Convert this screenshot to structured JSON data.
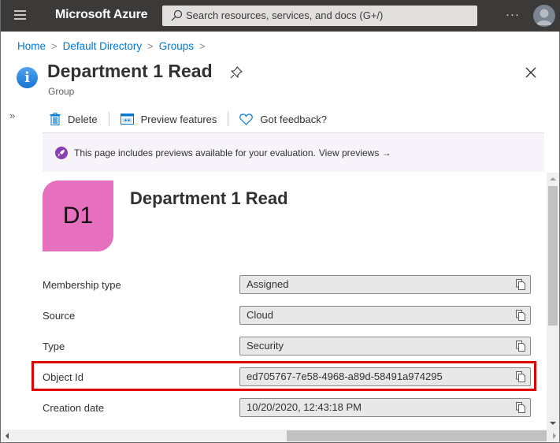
{
  "topbar": {
    "brand": "Microsoft Azure",
    "search_placeholder": "Search resources, services, and docs (G+/)",
    "more_label": "···",
    "menu_icon": "hamburger-icon",
    "avatar_icon": "user-avatar-icon"
  },
  "breadcrumb": {
    "items": [
      "Home",
      "Default Directory",
      "Groups"
    ],
    "separator": ">"
  },
  "header": {
    "title": "Department 1 Read",
    "subtitle": "Group",
    "icon": "info-icon",
    "icon_glyph": "i"
  },
  "toolbar": {
    "delete_label": "Delete",
    "preview_label": "Preview features",
    "feedback_label": "Got feedback?",
    "expand_glyph": "»"
  },
  "banner": {
    "text": "This page includes previews available for your evaluation.",
    "link": "View previews →",
    "accent": "#8a3eb4"
  },
  "group": {
    "initials": "D1",
    "name": "Department 1 Read",
    "avatar_color": "#e670bd"
  },
  "fields": [
    {
      "label": "Membership type",
      "value": "Assigned"
    },
    {
      "label": "Source",
      "value": "Cloud"
    },
    {
      "label": "Type",
      "value": "Security"
    },
    {
      "label": "Object Id",
      "value": "ed705767-7e58-4968-a89d-58491a974295",
      "highlighted": true
    },
    {
      "label": "Creation date",
      "value": "10/20/2020, 12:43:18 PM"
    }
  ],
  "colors": {
    "topbar": "#3b3a39",
    "link": "#0078d4",
    "highlight": "#e00000"
  }
}
